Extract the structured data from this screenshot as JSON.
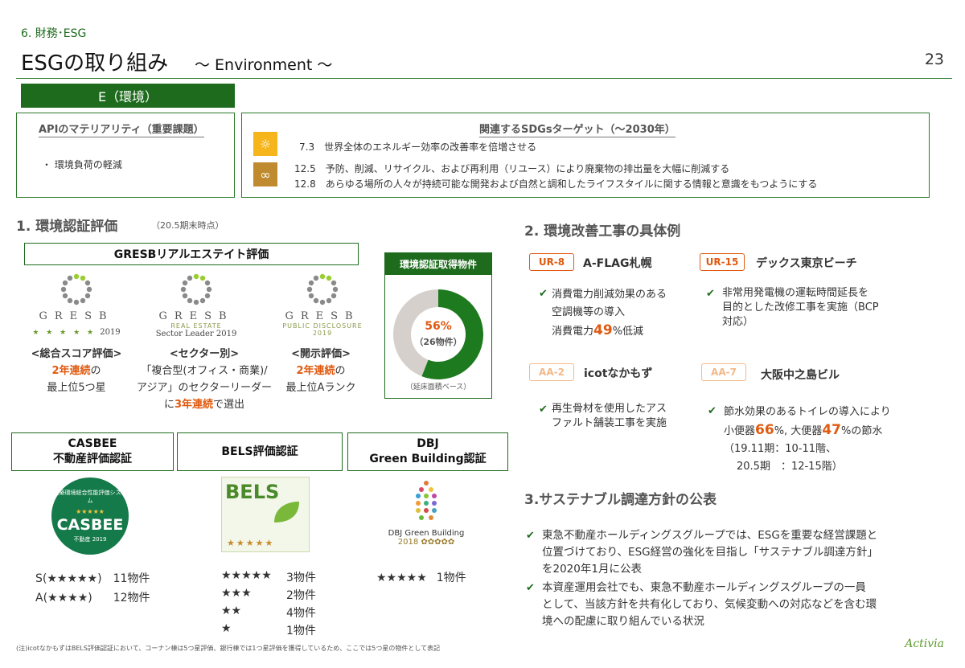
{
  "header": {
    "section": "6. 財務･ESG",
    "title": "ESGの取り組み",
    "subtitle": "～ Environment ～",
    "page_number": "23"
  },
  "e_tab": "E（環境）",
  "materiality": {
    "title": "APIのマテリアリティ（重要課題）",
    "item": "・ 環境負荷の軽減"
  },
  "sdgs": {
    "title": "関連するSDGsターゲット（～2030年）",
    "targets": [
      "7.3　世界全体のエネルギー効率の改善率を倍増させる",
      "12.5　予防、削減、リサイクル、および再利用（リユース）により廃棄物の排出量を大幅に削減する",
      "12.8　あらゆる場所の人々が持続可能な開発および自然と調和したライフスタイルに関する情報と意識をもつようにする"
    ]
  },
  "sec1": {
    "title": "1. 環境認証評価",
    "note": "（20.5期末時点）",
    "gresb_head": "GRESBリアルエステイト評価",
    "gresb_logos": [
      {
        "word": "GRESB",
        "stars": "★ ★ ★ ★ ★",
        "year": "2019",
        "sub": ""
      },
      {
        "word": "GRESB",
        "stars": "",
        "year": "Sector Leader 2019",
        "sub": "REAL ESTATE"
      },
      {
        "word": "GRESB",
        "stars": "",
        "year": "",
        "sub": "PUBLIC DISCLOSURE 2019"
      }
    ],
    "gresb_cols": [
      {
        "head": "<総合スコア評価>",
        "hl": "2年連続",
        "tail": "の",
        "line2": "最上位5つ星"
      },
      {
        "head": "<セクター別>",
        "line1": "「複合型(オフィス・商業)/",
        "line2": "アジア」のセクターリーダー",
        "pre": "に",
        "hl": "3年連続",
        "post": "で選出"
      },
      {
        "head": "<開示評価>",
        "hl": "2年連続",
        "tail": "の",
        "line2": "最上位Aランク"
      }
    ],
    "cert_panel": {
      "title": "環境認証取得物件",
      "percent": "56%",
      "count": "（26物件）",
      "note": "（延床面積ベース）"
    },
    "certs": [
      {
        "name_l1": "CASBEE",
        "name_l2": "不動産評価認証",
        "logo_text": "CASBEE",
        "logo_sub": "不動産 2019",
        "logo_top": "建築環境総合性能評価システム"
      },
      {
        "name_l1": "BELS評価認証",
        "name_l2": "",
        "logo_text": "BELS"
      },
      {
        "name_l1": "DBJ",
        "name_l2": "Green Building認証",
        "logo_text": "DBJ Green Building",
        "logo_year": "2018"
      }
    ],
    "casbee_rows": [
      {
        "rank": "S(★★★★★)",
        "count": "11物件"
      },
      {
        "rank": "A(★★★★)",
        "count": "12物件"
      }
    ],
    "bels_rows": [
      {
        "rank": "★★★★★",
        "count": "3物件"
      },
      {
        "rank": "★★★",
        "count": "2物件"
      },
      {
        "rank": "★★",
        "count": "4物件"
      },
      {
        "rank": "★",
        "count": "1物件"
      }
    ],
    "dbj_rows": [
      {
        "rank": "★★★★★",
        "count": "1物件"
      }
    ]
  },
  "sec2": {
    "title": "2. 環境改善工事の具体例",
    "items": [
      {
        "badge": "UR-8",
        "name": "A-FLAG札幌",
        "l1": "消費電力削減効果のある",
        "l2": "空調機等の導入",
        "l3_pre": "消費電力",
        "l3_hl": "49",
        "l3_post": "%低減"
      },
      {
        "badge": "UR-15",
        "name": "デックス東京ビーチ",
        "l1": "非常用発電機の運転時間延長を",
        "l2": "目的とした改修工事を実施（BCP",
        "l3": "対応）"
      },
      {
        "badge": "AA-2",
        "name": "icotなかもず",
        "l1": "再生骨材を使用したアス",
        "l2": "ファルト舗装工事を実施"
      },
      {
        "badge": "AA-7",
        "name": "大阪中之島ビル",
        "l1": "節水効果のあるトイレの導入により",
        "l2_a": "小便器",
        "l2_b": "66",
        "l2_c": "%, 大便器",
        "l2_d": "47",
        "l2_e": "%の節水",
        "l3": "（19.11期：10-11階、",
        "l4": "20.5期　：12-15階）"
      }
    ]
  },
  "sec3": {
    "title": "3.サステナブル調達方針の公表",
    "paras": [
      [
        "東急不動産ホールディングスグループでは、ESGを重要な経営課題と",
        "位置づけており、ESG経営の強化を目指し「サステナブル調達方針」",
        "を2020年1月に公表"
      ],
      [
        "本資産運用会社でも、東急不動産ホールディングスグループの一員",
        "として、当該方針を共有化しており、気候変動への対応などを含む環",
        "境への配慮に取り組んでいる状況"
      ]
    ]
  },
  "footnote": "(注)icotなかもずはBELS評価認証において、コーナン棟は5つ星評価、銀行棟では1つ星評価を獲得しているため、ここでは5つ星の物件として表記",
  "logo": "Activia",
  "chart_data": {
    "type": "pie",
    "values": [
      56,
      44
    ],
    "colors": [
      "#1e7a1e",
      "#d6d0cc"
    ]
  }
}
